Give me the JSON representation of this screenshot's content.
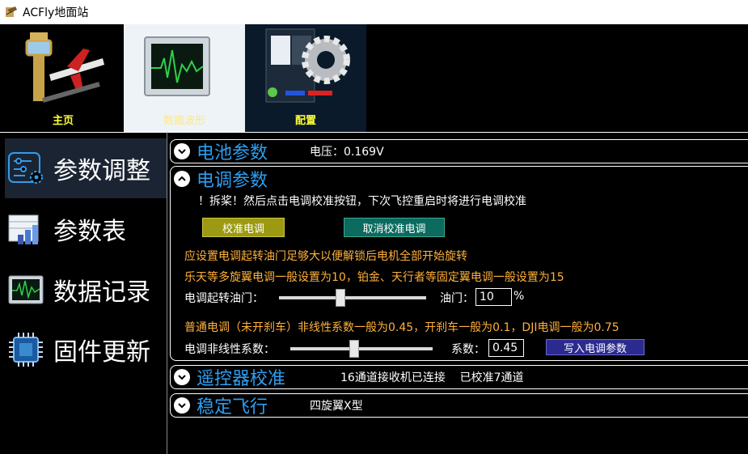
{
  "window": {
    "title": "ACFly地面站"
  },
  "toolbar": {
    "tabs": [
      {
        "label": "主页"
      },
      {
        "label": "数据波形"
      },
      {
        "label": "配置"
      }
    ]
  },
  "sidebar": {
    "items": [
      {
        "label": "参数调整"
      },
      {
        "label": "参数表"
      },
      {
        "label": "数据记录"
      },
      {
        "label": "固件更新"
      }
    ]
  },
  "sections": {
    "battery": {
      "title": "电池参数",
      "info": "电压：0.169V"
    },
    "esc": {
      "title": "电调参数",
      "notice": "！拆桨！然后点击电调校准按钮，下次飞控重启时将进行电调校准",
      "calibrate_button": "校准电调",
      "cancel_calibrate_button": "取消校准电调",
      "hint_spin": "应设置电调起转油门足够大以便解锁后电机全部开始旋转",
      "hint_types": "乐天等多旋翼电调一般设置为10，铂金、天行者等固定翼电调一般设置为15",
      "throttle_label": "电调起转油门：",
      "throttle_value_label": "油门：",
      "throttle_value": "10",
      "throttle_unit": "%",
      "throttle_slider_level": 0.42,
      "hint_nonlinear": "普通电调（未开刹车）非线性系数一般为0.45，开刹车一般为0.1，DJI电调一般为0.75",
      "nonlinear_label": "电调非线性系数：",
      "coef_label": "系数：",
      "coef_value": "0.45",
      "nonlinear_slider_level": 0.45,
      "write_button": "写入电调参数"
    },
    "rc": {
      "title": "遥控器校准",
      "info": "16通道接收机已连接    已校准7通道"
    },
    "stable": {
      "title": "稳定飞行",
      "info": "四旋翼X型"
    }
  },
  "colors": {
    "accent": "#2e9ef0",
    "hint": "#ffb13b",
    "tab_label": "#ffff33",
    "calibrate_btn": "#9c9a12",
    "cancel_btn": "#0c6a5e",
    "write_btn": "#2b2b8f"
  }
}
